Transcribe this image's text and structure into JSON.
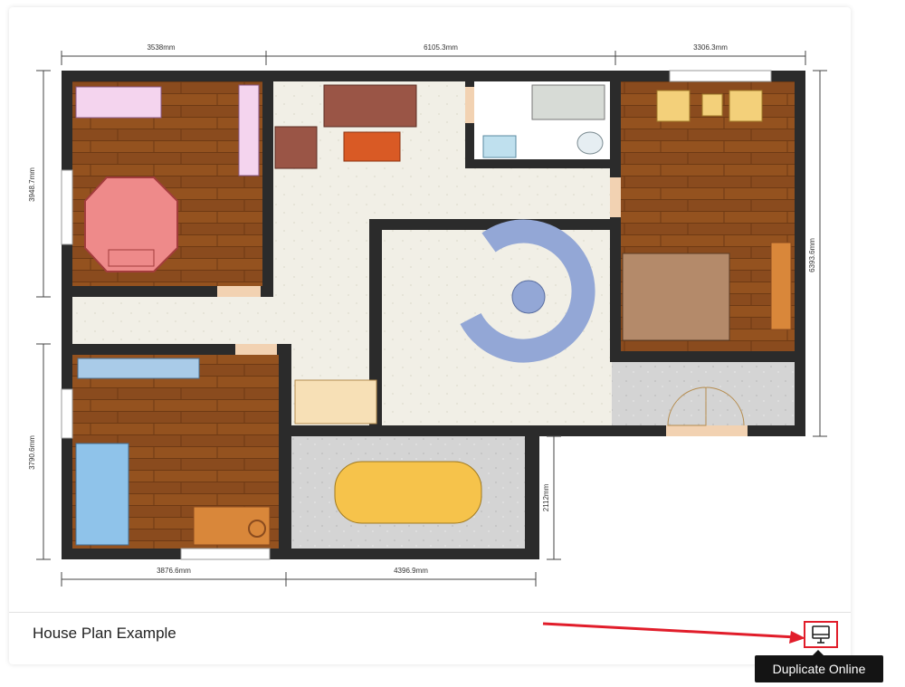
{
  "card": {
    "title": "House Plan Example",
    "action_icon": "monitor-icon",
    "tooltip": "Duplicate Online"
  },
  "plan": {
    "dims": {
      "top_left": "3538mm",
      "top_mid": "6105.3mm",
      "top_right": "3306.3mm",
      "left_top": "3948.7mm",
      "left_bottom": "3790.6mm",
      "right": "6393.6mm",
      "bottom_left": "3876.6mm",
      "bottom_mid": "4396.9mm",
      "garage": "2112mm"
    }
  },
  "colors": {
    "wall": "#2b2b2b",
    "wood": "#8a4b1e",
    "floor": "#f1efe6",
    "garage": "#d6d6d6",
    "annotation": "#e11d2a"
  }
}
